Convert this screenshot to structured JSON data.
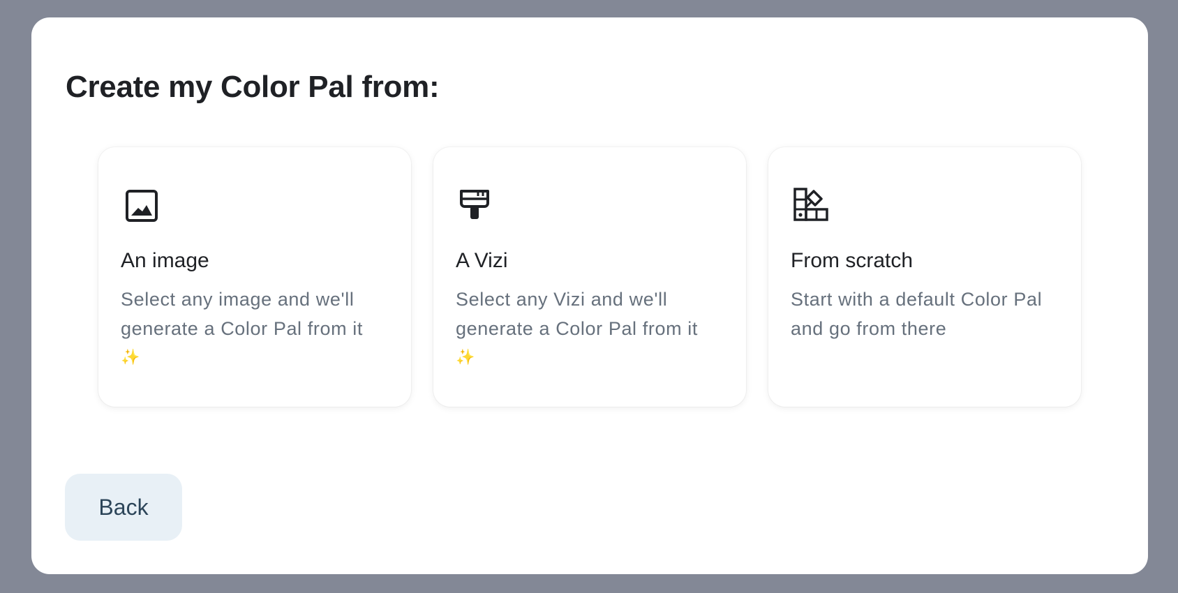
{
  "modal": {
    "title": "Create my Color Pal from:"
  },
  "options": [
    {
      "icon": "image-icon",
      "title": "An image",
      "description": "Select any image and we'll generate a Color Pal from it",
      "emoji": "✨"
    },
    {
      "icon": "paintbrush-icon",
      "title": "A Vizi",
      "description": "Select any Vizi and we'll generate a Color Pal from it",
      "emoji": "✨"
    },
    {
      "icon": "swatches-icon",
      "title": "From scratch",
      "description": "Start with a default Color Pal and go from there"
    }
  ],
  "footer": {
    "back_label": "Back"
  },
  "colors": {
    "backdrop": "#838896",
    "text_primary": "#1f2125",
    "text_secondary": "#66707c",
    "button_bg": "#e8f0f6",
    "button_text": "#2c4559"
  }
}
